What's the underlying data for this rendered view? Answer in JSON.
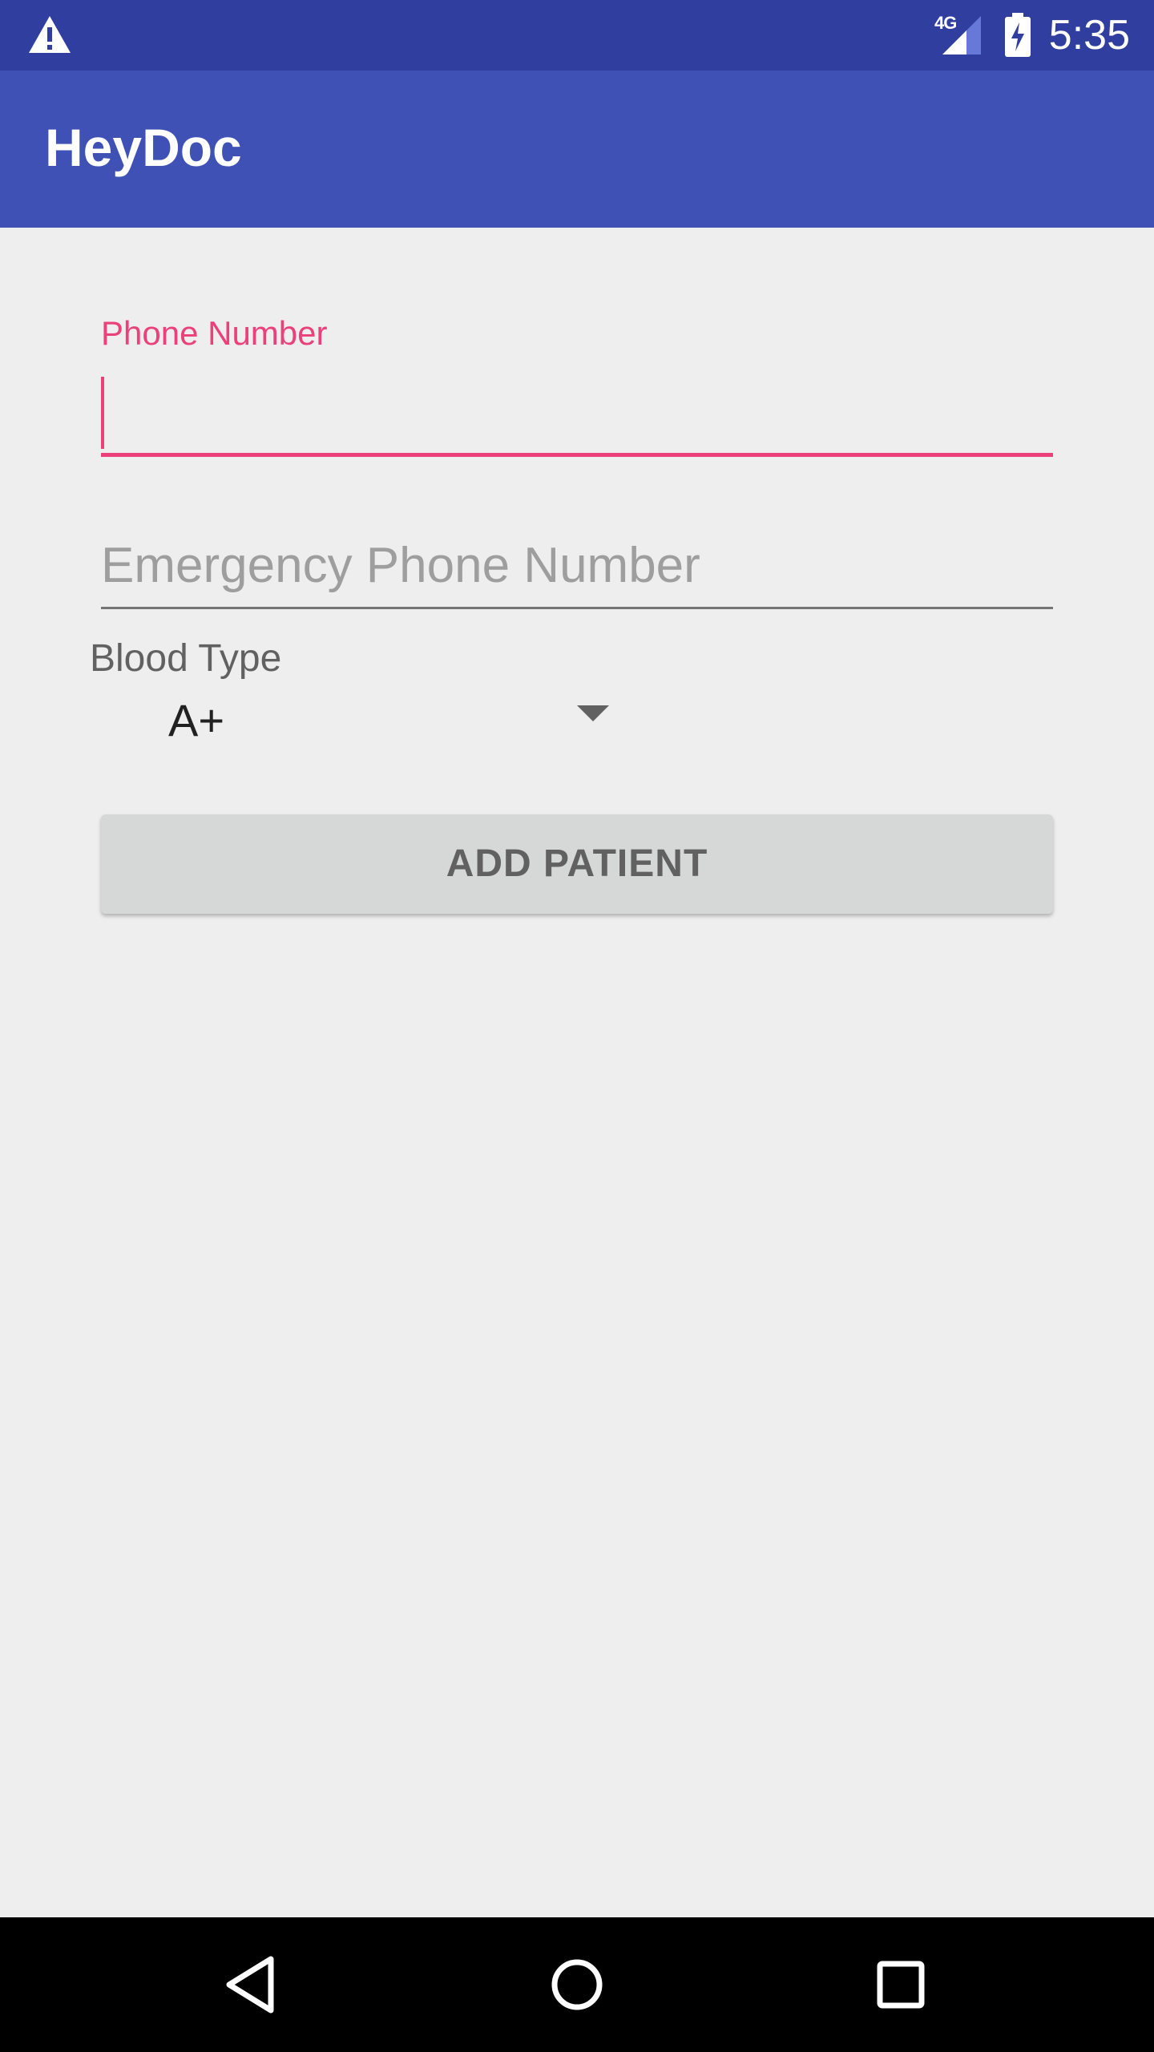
{
  "status_bar": {
    "time": "5:35",
    "network_label": "4G",
    "icons": [
      "warning-icon",
      "signal-icon",
      "battery-charging-icon"
    ]
  },
  "app_bar": {
    "title": "HeyDoc"
  },
  "form": {
    "phone": {
      "label": "Phone Number",
      "value": ""
    },
    "emergency_phone": {
      "placeholder": "Emergency Phone Number",
      "value": ""
    },
    "blood_type": {
      "label": "Blood Type",
      "selected": "A+"
    },
    "submit_label": "ADD PATIENT"
  },
  "nav_bar": {
    "icons": [
      "back-icon",
      "home-icon",
      "recents-icon"
    ]
  },
  "colors": {
    "primary": "#3f51b5",
    "primary_dark": "#303f9f",
    "accent": "#ec407a",
    "background": "#eeeeee"
  }
}
